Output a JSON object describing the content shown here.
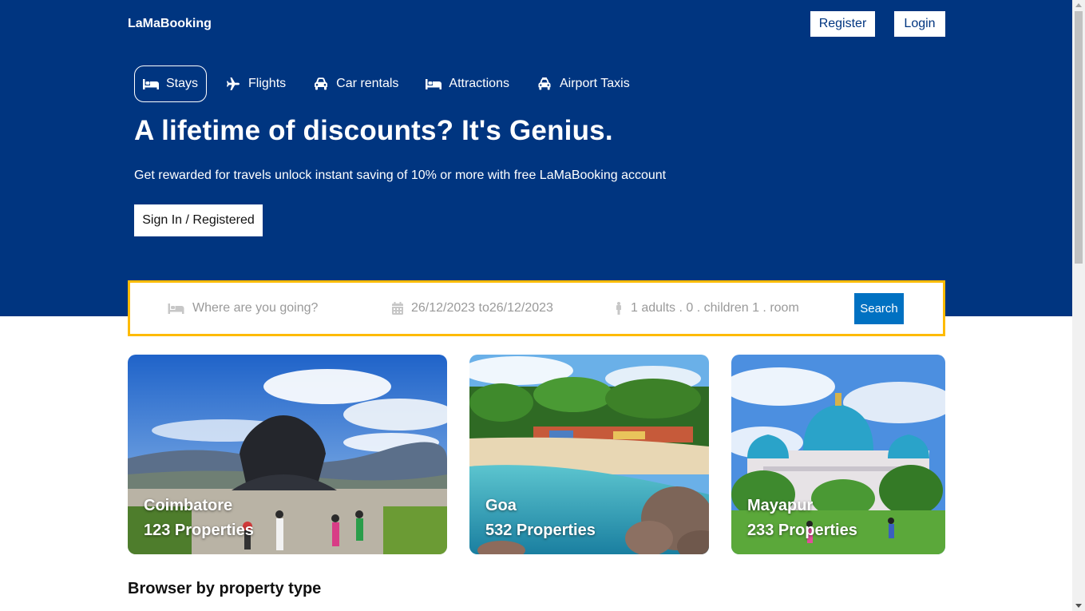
{
  "navbar": {
    "logo": "LaMaBooking",
    "register_label": "Register",
    "login_label": "Login"
  },
  "tabs": [
    {
      "label": "Stays",
      "icon": "bed-icon",
      "active": true
    },
    {
      "label": "Flights",
      "icon": "plane-icon"
    },
    {
      "label": "Car rentals",
      "icon": "car-icon"
    },
    {
      "label": "Attractions",
      "icon": "bed-icon"
    },
    {
      "label": "Airport Taxis",
      "icon": "taxi-icon"
    }
  ],
  "hero": {
    "title": "A lifetime of discounts? It's Genius.",
    "description": "Get rewarded for travels unlock instant saving of 10% or more with free LaMaBooking account",
    "signin_label": "Sign In / Registered"
  },
  "search": {
    "destination_placeholder": "Where are you going?",
    "date_range": "26/12/2023 to26/12/2023",
    "options": "1 adults . 0 . children 1 . room",
    "button_label": "Search"
  },
  "featured": [
    {
      "city": "Coimbatore",
      "properties": "123 Properties"
    },
    {
      "city": "Goa",
      "properties": "532 Properties"
    },
    {
      "city": "Mayapur",
      "properties": "233 Properties"
    }
  ],
  "section_title": "Browser by property type",
  "colors": {
    "brand_blue": "#003580",
    "search_border": "#febb02",
    "button_blue": "#0071c2"
  }
}
